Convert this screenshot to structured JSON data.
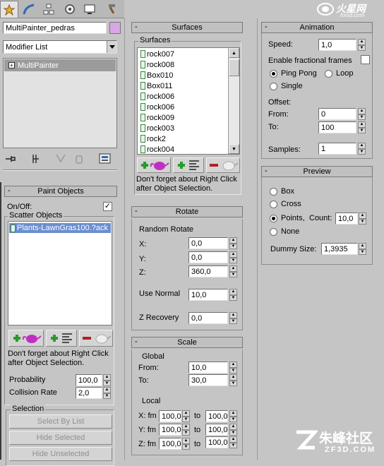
{
  "watermark_top": {
    "brand": "火星网",
    "url": "hxsd.com"
  },
  "watermark_bottom": {
    "brand": "朱峰社区",
    "url": "ZF3D.COM"
  },
  "modify_panel": {
    "object_name": "MultiPainter_pedras",
    "color_swatch": "#d9a6e6",
    "modifier_list": "Modifier List",
    "stack_item": "MultiPainter"
  },
  "paint_objects": {
    "title": "Paint Objects",
    "on_off_label": "On/Off:",
    "on_off_checked": "✓",
    "scatter_group": "Scatter Objects",
    "scatter_item": "Plants-LawnGras100.?ack",
    "hint": "Don't forget about Right Click after Object Selection.",
    "probability_label": "Probability",
    "probability_value": "100,0",
    "collision_label": "Collision Rate",
    "collision_value": "2,0",
    "selection_group": "Selection",
    "buttons": [
      "Select By List",
      "Hide Selected",
      "Hide Unselected"
    ]
  },
  "surfaces": {
    "title": "Surfaces",
    "group": "Surfaces",
    "items": [
      "rock007",
      "rock008",
      "Box010",
      "Box011",
      "rock006",
      "rock006",
      "rock009",
      "rock003",
      "rock2",
      "rock004"
    ],
    "hint": "Don't forget about Right Click after Object Selection."
  },
  "rotate": {
    "title": "Rotate",
    "random_label": "Random Rotate",
    "x_label": "X:",
    "x_value": "0,0",
    "y_label": "Y:",
    "y_value": "0,0",
    "z_label": "Z:",
    "z_value": "360,0",
    "use_normal_label": "Use Normal",
    "use_normal_value": "10,0",
    "z_recovery_label": "Z Recovery",
    "z_recovery_value": "0,0"
  },
  "scale": {
    "title": "Scale",
    "global_label": "Global",
    "from_label": "From:",
    "from_value": "10,0",
    "to_label": "To:",
    "to_value": "30,0",
    "local_label": "Local",
    "rows": [
      {
        "label": "X: fm",
        "fm": "100,0",
        "to_label": "to",
        "to": "100,0"
      },
      {
        "label": "Y: fm",
        "fm": "100,0",
        "to_label": "to",
        "to": "100,0"
      },
      {
        "label": "Z: fm",
        "fm": "100,0",
        "to_label": "to",
        "to": "100,0"
      }
    ]
  },
  "animation": {
    "title": "Animation",
    "speed_label": "Speed:",
    "speed_value": "1,0",
    "fractional_label": "Enable fractional frames",
    "pingpong_label": "Ping Pong",
    "loop_label": "Loop",
    "single_label": "Single",
    "offset_label": "Offset:",
    "from_label": "From:",
    "from_value": "0",
    "to_label": "To:",
    "to_value": "100",
    "samples_label": "Samples:",
    "samples_value": "1"
  },
  "preview": {
    "title": "Preview",
    "box_label": "Box",
    "cross_label": "Cross",
    "points_label": "Points,",
    "count_label": "Count:",
    "count_value": "10,0",
    "none_label": "None",
    "dummy_label": "Dummy Size:",
    "dummy_value": "1,3935"
  }
}
